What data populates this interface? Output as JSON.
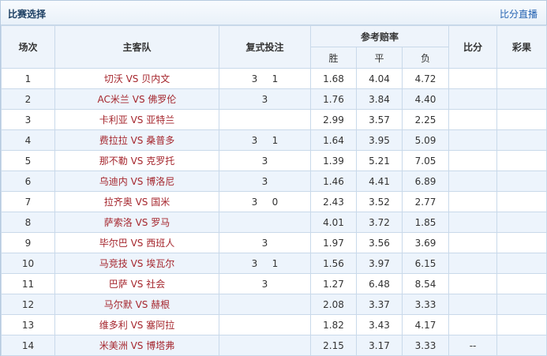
{
  "header": {
    "title": "比赛选择",
    "live_link": "比分直播"
  },
  "columns": {
    "num": "场次",
    "teams": "主客队",
    "multi": "复式投注",
    "odds": "参考赔率",
    "win": "胜",
    "draw": "平",
    "loss": "负",
    "score": "比分",
    "lottery": "彩果"
  },
  "rows": [
    {
      "num": "1",
      "home": "切沃",
      "away": "贝内文",
      "picks": [
        "3",
        "1"
      ],
      "win": "1.68",
      "draw": "4.04",
      "loss": "4.72",
      "score": "",
      "lottery": ""
    },
    {
      "num": "2",
      "home": "AC米兰",
      "away": "佛罗伦",
      "picks": [
        "3"
      ],
      "win": "1.76",
      "draw": "3.84",
      "loss": "4.40",
      "score": "",
      "lottery": ""
    },
    {
      "num": "3",
      "home": "卡利亚",
      "away": "亚特兰",
      "picks": [],
      "win": "2.99",
      "draw": "3.57",
      "loss": "2.25",
      "score": "",
      "lottery": ""
    },
    {
      "num": "4",
      "home": "费拉拉",
      "away": "桑普多",
      "picks": [
        "3",
        "1"
      ],
      "win": "1.64",
      "draw": "3.95",
      "loss": "5.09",
      "score": "",
      "lottery": ""
    },
    {
      "num": "5",
      "home": "那不勒",
      "away": "克罗托",
      "picks": [
        "3"
      ],
      "win": "1.39",
      "draw": "5.21",
      "loss": "7.05",
      "score": "",
      "lottery": ""
    },
    {
      "num": "6",
      "home": "乌迪内",
      "away": "博洛尼",
      "picks": [
        "3"
      ],
      "win": "1.46",
      "draw": "4.41",
      "loss": "6.89",
      "score": "",
      "lottery": ""
    },
    {
      "num": "7",
      "home": "拉齐奥",
      "away": "国米",
      "picks": [
        "3",
        "0"
      ],
      "win": "2.43",
      "draw": "3.52",
      "loss": "2.77",
      "score": "",
      "lottery": ""
    },
    {
      "num": "8",
      "home": "萨索洛",
      "away": "罗马",
      "picks": [],
      "win": "4.01",
      "draw": "3.72",
      "loss": "1.85",
      "score": "",
      "lottery": ""
    },
    {
      "num": "9",
      "home": "毕尔巴",
      "away": "西班人",
      "picks": [
        "3"
      ],
      "win": "1.97",
      "draw": "3.56",
      "loss": "3.69",
      "score": "",
      "lottery": ""
    },
    {
      "num": "10",
      "home": "马竞技",
      "away": "埃瓦尔",
      "picks": [
        "3",
        "1"
      ],
      "win": "1.56",
      "draw": "3.97",
      "loss": "6.15",
      "score": "",
      "lottery": ""
    },
    {
      "num": "11",
      "home": "巴萨",
      "away": "社会",
      "picks": [
        "3"
      ],
      "win": "1.27",
      "draw": "6.48",
      "loss": "8.54",
      "score": "",
      "lottery": ""
    },
    {
      "num": "12",
      "home": "马尔默",
      "away": "赫根",
      "picks": [],
      "win": "2.08",
      "draw": "3.37",
      "loss": "3.33",
      "score": "",
      "lottery": ""
    },
    {
      "num": "13",
      "home": "维多利",
      "away": "塞阿拉",
      "picks": [],
      "win": "1.82",
      "draw": "3.43",
      "loss": "4.17",
      "score": "",
      "lottery": ""
    },
    {
      "num": "14",
      "home": "米美洲",
      "away": "博塔弗",
      "picks": [],
      "win": "2.15",
      "draw": "3.17",
      "loss": "3.33",
      "score": "--",
      "lottery": ""
    }
  ],
  "vs_text": "VS"
}
